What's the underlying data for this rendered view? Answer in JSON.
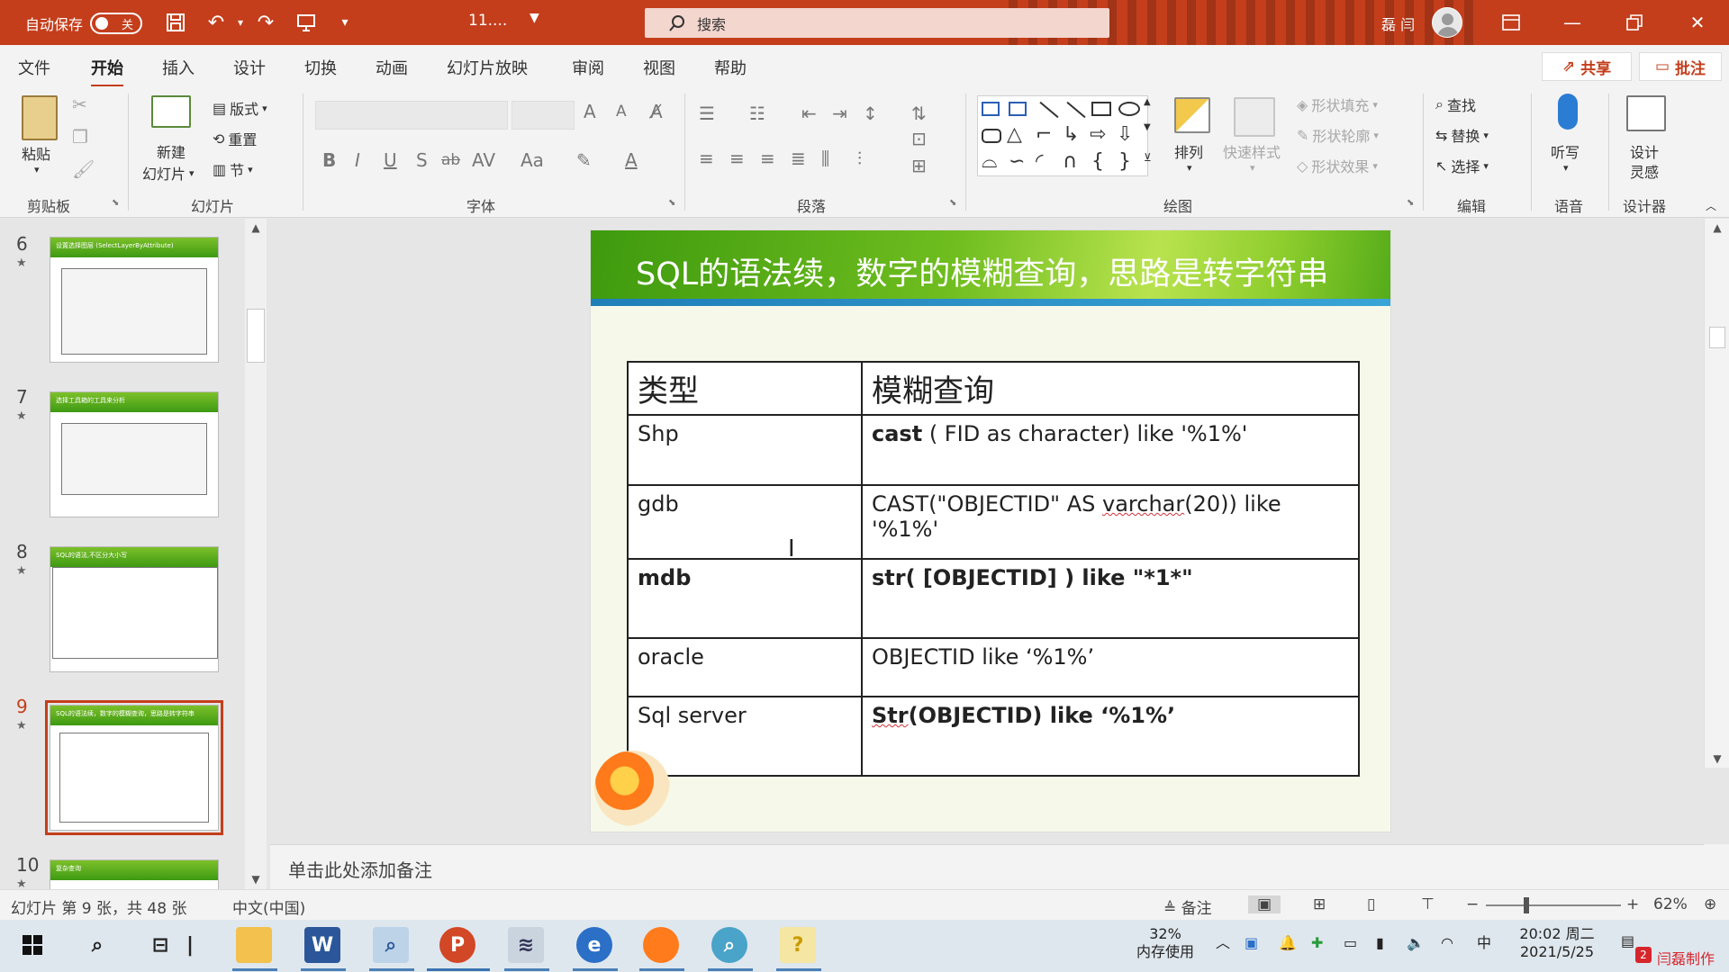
{
  "titlebar": {
    "autosave_label": "自动保存",
    "autosave_state": "关",
    "doc_title": "11....",
    "search_placeholder": "搜索",
    "user_name": "磊 闫"
  },
  "menu": {
    "tabs": [
      "文件",
      "开始",
      "插入",
      "设计",
      "切换",
      "动画",
      "幻灯片放映",
      "审阅",
      "视图",
      "帮助"
    ],
    "active_tab": "开始",
    "share_label": "共享",
    "comment_label": "批注"
  },
  "ribbon": {
    "clipboard": {
      "paste": "粘贴",
      "group": "剪贴板"
    },
    "slides": {
      "new_slide_1": "新建",
      "new_slide_2": "幻灯片",
      "layout": "版式",
      "reset": "重置",
      "section": "节",
      "group": "幻灯片"
    },
    "font": {
      "group": "字体",
      "bold": "B",
      "italic": "I",
      "underline": "U",
      "strike": "S",
      "strike2": "ab",
      "spacing": "AV",
      "case": "Aa"
    },
    "paragraph": {
      "group": "段落"
    },
    "drawing": {
      "arrange": "排列",
      "quick_styles": "快速样式",
      "fill": "形状填充",
      "outline": "形状轮廓",
      "effects": "形状效果",
      "group": "绘图"
    },
    "editing": {
      "find": "查找",
      "replace": "替换",
      "select": "选择",
      "group": "编辑"
    },
    "voice": {
      "dictate": "听写",
      "group": "语音"
    },
    "designer": {
      "design_1": "设计",
      "design_2": "灵感",
      "group": "设计器"
    }
  },
  "thumbnails": [
    {
      "num": "6",
      "title": "设置选择图层 (SelectLayerByAttribute)"
    },
    {
      "num": "7",
      "title": "选择工具箱的工具来分析"
    },
    {
      "num": "8",
      "title": "SQL的语法,不区分大小写"
    },
    {
      "num": "9",
      "title": "SQL的语法续，数字的模糊查询，思路是转字符串"
    },
    {
      "num": "10",
      "title": "复杂查询"
    }
  ],
  "active_slide": "9",
  "slide": {
    "title": "SQL的语法续，数字的模糊查询，思路是转字符串",
    "table": {
      "headers": [
        "类型",
        "模糊查询"
      ],
      "rows": [
        {
          "type": "Shp",
          "query_bold": "cast",
          "query_rest": " ( FID as character) like '%1%'"
        },
        {
          "type": "gdb",
          "query_a": "CAST(\"OBJECTID\" AS  ",
          "query_squiggle": "varchar",
          "query_b": "(20))  like '%1%'"
        },
        {
          "type": "mdb",
          "query": "str( [OBJECTID] ) like \"*1*\""
        },
        {
          "type": "oracle",
          "query": "OBJECTID like ‘%1%’"
        },
        {
          "type": "Sql server",
          "query_squiggle": "Str",
          "query_rest": "(OBJECTID) like ‘%1%’"
        }
      ]
    }
  },
  "notes_placeholder": "单击此处添加备注",
  "status": {
    "slide_info": "幻灯片 第 9 张，共 48 张",
    "language": "中文(中国)",
    "notes_button": "备注",
    "zoom": "62%"
  },
  "taskbar": {
    "memory_percent": "32%",
    "memory_label": "内存使用",
    "ime": "中",
    "time": "20:02 周二",
    "date": "2021/5/25",
    "badge": "2",
    "watermark": "闫磊制作"
  },
  "colors": {
    "accent": "#c43e1c",
    "slide_green": "#5cb31a"
  }
}
